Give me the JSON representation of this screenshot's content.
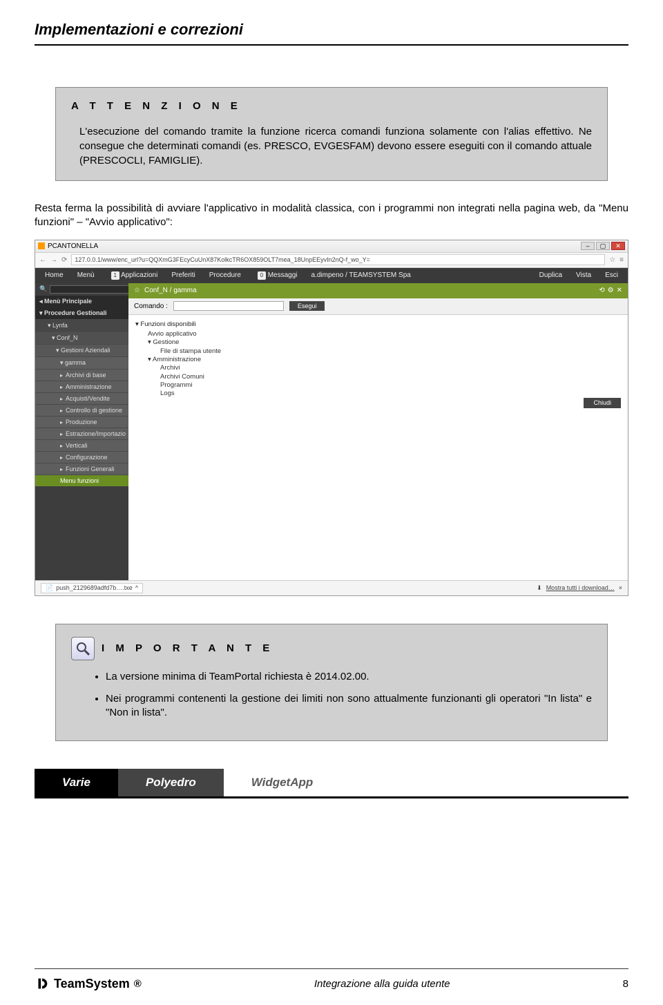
{
  "header": {
    "title": "Implementazioni e correzioni"
  },
  "attention": {
    "title": "A T T E N Z I O N E",
    "body": "L'esecuzione del comando tramite la funzione ricerca comandi funziona solamente con l'alias effettivo. Ne consegue che determinati comandi (es. PRESCO, EVGESFAM) devono essere eseguiti con il comando attuale (PRESCOCLI, FAMIGLIE)."
  },
  "paragraph": "Resta ferma la possibilità di avviare l'applicativo in modalità classica, con i programmi non integrati nella pagina web, da \"Menu funzioni\" – \"Avvio applicativo\":",
  "screenshot": {
    "windowTitle": "PCANTONELLA",
    "url": "127.0.0.1/www/enc_url?u=QQXmG3FEcyCuUnX87KolkcTR6OX859OLT7mea_18UnpEEyvIn2nQ-f_wo_Y=",
    "menus": {
      "home": "Home",
      "menu": "Menù",
      "applicazioni": "Applicazioni",
      "appCount": "1",
      "preferiti": "Preferiti",
      "procedure": "Procedure",
      "messaggi": "Messaggi",
      "msgCount": "0",
      "user": "a.dimpeno / TEAMSYSTEM Spa",
      "duplica": "Duplica",
      "vista": "Vista",
      "esci": "Esci"
    },
    "tab": {
      "title": "Conf_N / gamma"
    },
    "sidebar": {
      "principale": "Menù Principale",
      "procedure": "Procedure Gestionali",
      "lynfa": "Lynfa",
      "confn": "Conf_N",
      "gestioni": "Gestioni Aziendali",
      "gamma": "gamma",
      "arch": "Archivi di base",
      "amm": "Amministrazione",
      "acq": "Acquisti/Vendite",
      "ctrl": "Controllo di gestione",
      "prod": "Produzione",
      "estr": "Estrazione/Importazio",
      "vert": "Verticali",
      "conf": "Configurazione",
      "fgen": "Funzioni Generali",
      "mfun": "Menu funzioni"
    },
    "cmd": {
      "label": "Comando :",
      "esegui": "Esegui"
    },
    "functions": {
      "header": "Funzioni disponibili",
      "avvio": "Avvio applicativo",
      "gestione": "Gestione",
      "stampa": "File di stampa utente",
      "amm": "Amministrazione",
      "archivi": "Archivi",
      "archivic": "Archivi Comuni",
      "prog": "Programmi",
      "logs": "Logs"
    },
    "chiudi": "Chiudi",
    "download": {
      "file": "push_2129689adfd7b….txe",
      "all": "Mostra tutti i download…",
      "close": "×"
    }
  },
  "importante": {
    "title": "I M P O R T A N T E",
    "bullet1": "La versione minima di TeamPortal richiesta è 2014.02.00.",
    "bullet2": "Nei programmi contenenti la gestione dei limiti non sono attualmente funzionanti gli operatori \"In lista\" e \"Non in lista\"."
  },
  "section": {
    "col1": "Varie",
    "col2": "Polyedro",
    "col3": "WidgetApp"
  },
  "footer": {
    "brand": "TeamSystem",
    "reg": "®",
    "center": "Integrazione alla guida utente",
    "page": "8"
  }
}
